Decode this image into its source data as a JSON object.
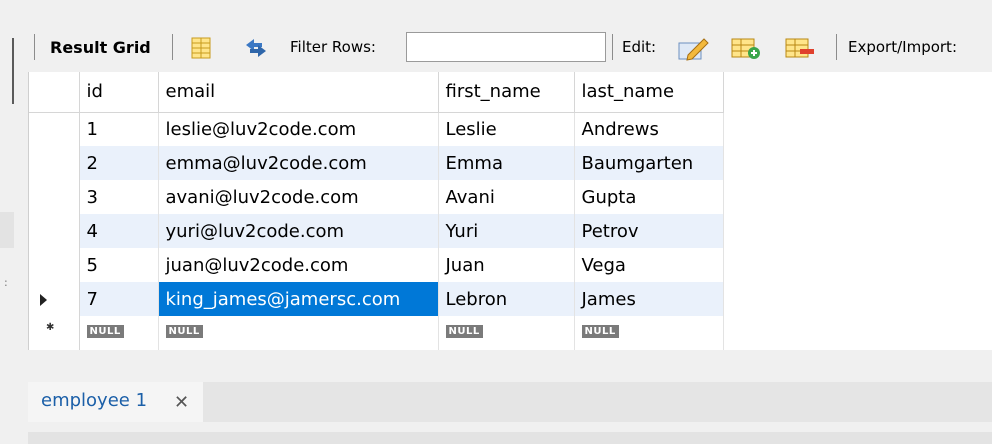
{
  "toolbar": {
    "result_grid_label": "Result Grid",
    "filter_label": "Filter Rows:",
    "filter_value": "",
    "edit_label": "Edit:",
    "export_label": "Export/Import:"
  },
  "grid": {
    "columns": [
      "id",
      "email",
      "first_name",
      "last_name"
    ],
    "rows": [
      {
        "id": "1",
        "email": "leslie@luv2code.com",
        "first_name": "Leslie",
        "last_name": "Andrews"
      },
      {
        "id": "2",
        "email": "emma@luv2code.com",
        "first_name": "Emma",
        "last_name": "Baumgarten"
      },
      {
        "id": "3",
        "email": "avani@luv2code.com",
        "first_name": "Avani",
        "last_name": "Gupta"
      },
      {
        "id": "4",
        "email": "yuri@luv2code.com",
        "first_name": "Yuri",
        "last_name": "Petrov"
      },
      {
        "id": "5",
        "email": "juan@luv2code.com",
        "first_name": "Juan",
        "last_name": "Vega"
      },
      {
        "id": "7",
        "email": "king_james@jamersc.com",
        "first_name": "Lebron",
        "last_name": "James"
      }
    ],
    "null_label": "NULL"
  },
  "tabs": {
    "active_label": "employee 1",
    "close_glyph": "✕"
  },
  "colors": {
    "selection": "#0078d7",
    "alt_row": "#eaf1fb",
    "tab_text": "#1b5fa8"
  }
}
